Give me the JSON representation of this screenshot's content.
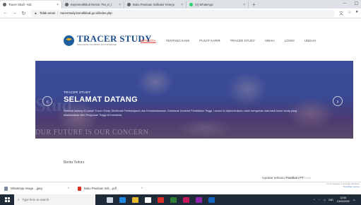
{
  "browser": {
    "tabs": [
      {
        "title": "Tracer Studi - Kdi",
        "icon": "site-favicon",
        "active": true
      },
      {
        "title": "Kepmendikbud Nomor 794_E_I",
        "icon": "doc-favicon",
        "active": false
      },
      {
        "title": "Buku Panduan Indikator Kinerja",
        "icon": "doc-favicon",
        "active": false
      },
      {
        "title": "(3) WhatsApp",
        "icon": "whatsapp-favicon",
        "active": false
      }
    ],
    "new_tab": "+",
    "url_security": "Tidak aman",
    "url": "tracerstudy.kemdikbud.go.id/index.php"
  },
  "site": {
    "logo_title": "TRACER STUDY",
    "logo_subtitle": "Kementerian Pendidikan dan Kebudayaan",
    "menu": [
      "BERANDA",
      "TENTANG KAMI",
      "PUSAT KARIR",
      "TRACER STUDY",
      "HIBAH",
      "LOGIN",
      "UNDUH"
    ],
    "active_menu": "BERANDA"
  },
  "hero": {
    "ghost_text": "Stud",
    "kicker": "TRACER STUDY",
    "title": "SELAMAT DATANG",
    "body": "Selamat datang di Laman Tracer Study, Direktorat Pembelajaran dan Kemahasiswaan, Direktorat Jenderal Pendidikan Tinggi. Laman ini diperuntukkan untuk mengelola data hasil tracer study yang dilaksanakan oleh Perguruan Tinggi di Indonesia.",
    "banner": "DUR FUTURE IS OUR CONCERN",
    "prev": "‹",
    "next": "›"
  },
  "news": {
    "title": "Berita Terkini"
  },
  "update": {
    "prefix": "Update terbaru",
    "highlight": "Pastikan PT",
    "faint": "Activ"
  },
  "activation": {
    "line1": "Go to Settings to activate Windows",
    "line2": "Tampilkan semua"
  },
  "downloads": [
    {
      "name": "WhatsApp Image....jpeg",
      "type": "jpeg"
    },
    {
      "name": "Buku Panduan Indi....pdf",
      "type": "pdf"
    }
  ],
  "taskbar": {
    "search_placeholder": "Type here to search",
    "tray_lang": "IND",
    "time": "13:05",
    "date": "13/02/2020"
  },
  "colors": {
    "brand_blue": "#1f4e8c",
    "menu_active": "#e0443a",
    "taskbar": "#202b3a"
  }
}
